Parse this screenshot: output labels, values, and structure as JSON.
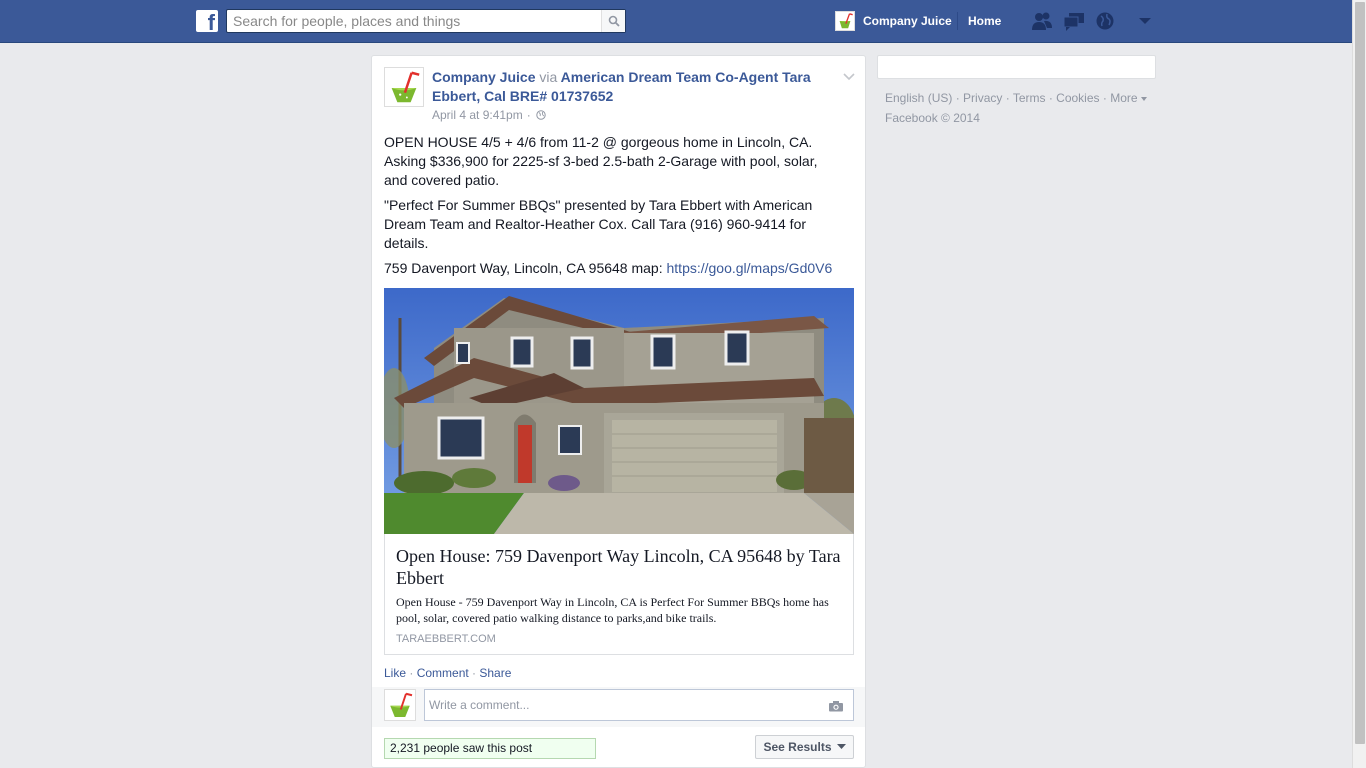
{
  "topbar": {
    "search_placeholder": "Search for people, places and things",
    "profile_name": "Company Juice",
    "home_label": "Home"
  },
  "post": {
    "author": "Company Juice",
    "via_label": "via",
    "via_page": "American Dream Team Co-Agent Tara Ebbert, Cal BRE# 01737652",
    "timestamp": "April 4 at 9:41pm",
    "time_sep": "·",
    "paragraph1": "OPEN HOUSE 4/5 + 4/6 from 11-2 @ gorgeous home in Lincoln, CA. Asking $336,900 for 2225-sf 3-bed 2.5-bath 2-Garage with pool, solar, and covered patio.",
    "paragraph2": "\"Perfect For Summer BBQs\" presented by Tara Ebbert with American Dream Team and Realtor-Heather Cox. Call Tara (916) 960-9414 for details.",
    "address_text": "759 Davenport Way, Lincoln, CA 95648 map: ",
    "map_link": "https://goo.gl/maps/Gd0V6",
    "link_title": "Open House: 759 Davenport Way Lincoln, CA 95648 by Tara Ebbert",
    "link_desc": "Open House - 759 Davenport Way in Lincoln, CA is Perfect For Summer BBQs home has pool, solar, covered patio walking distance to parks,and bike trails.",
    "link_domain": "TARAEBBERT.COM",
    "like_label": "Like",
    "comment_label": "Comment",
    "share_label": "Share",
    "dot": " · ",
    "comment_placeholder": "Write a comment...",
    "reach_text": "2,231 people saw this post",
    "see_results_label": "See Results"
  },
  "footer": {
    "links": [
      "English (US)",
      "Privacy",
      "Terms",
      "Cookies",
      "More"
    ],
    "sep": " · ",
    "copyright": "Facebook © 2014"
  },
  "colors": {
    "brand_blue": "#3b5998",
    "page_bg": "#e9eaed",
    "meta_gray": "#9197a3"
  },
  "icons": [
    "facebook-logo-icon",
    "search-icon",
    "friend-requests-icon",
    "messages-icon",
    "notifications-globe-icon",
    "caret-down-icon",
    "chevron-down-icon",
    "globe-icon",
    "camera-icon",
    "juice-glass-icon"
  ]
}
